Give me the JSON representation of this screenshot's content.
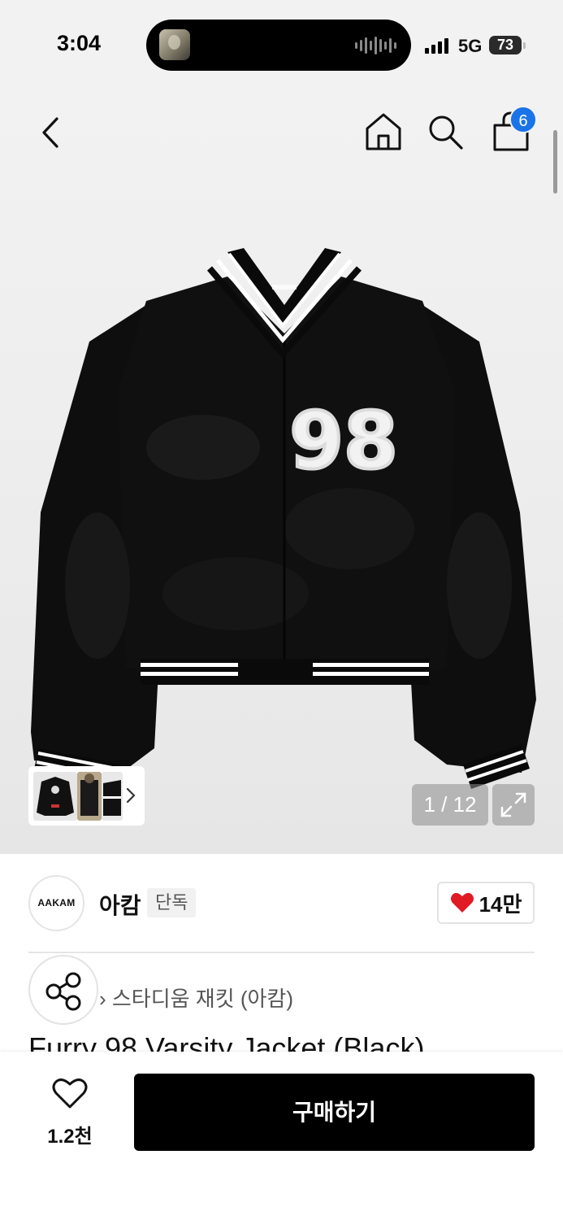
{
  "status_bar": {
    "time": "3:04",
    "network": "5G",
    "battery": "73"
  },
  "nav": {
    "cart_count": "6"
  },
  "gallery": {
    "counter": "1 / 12",
    "jacket_number": "98",
    "tag_text": "AAKAM"
  },
  "brand": {
    "logo_text": "AAKAM",
    "name": "아캄",
    "badge": "단독",
    "likes": "14만"
  },
  "category": {
    "breadcrumb": "› 스타디움 재킷 (아캄)"
  },
  "product": {
    "title": "Furry 98 Varsity Jacket (Black)"
  },
  "bottom_bar": {
    "wishlist_count": "1.2천",
    "buy_label": "구매하기"
  },
  "colors": {
    "accent_blue": "#1a73e8",
    "heart_red": "#e01b24",
    "button_black": "#000000"
  }
}
